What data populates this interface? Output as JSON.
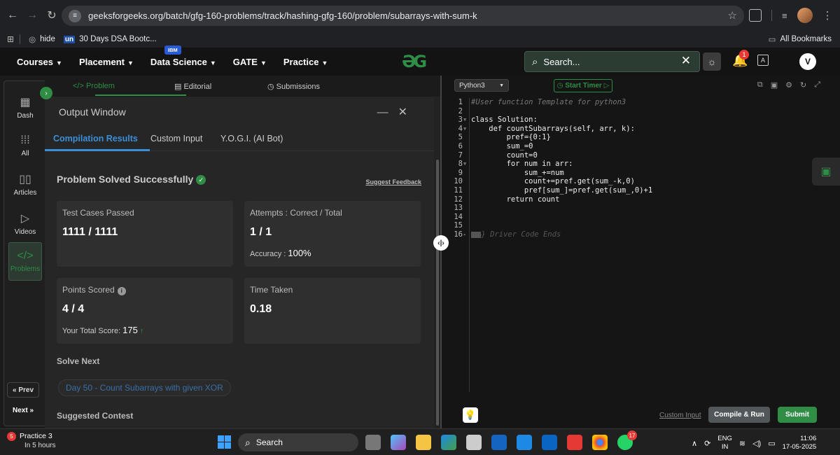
{
  "browser": {
    "url": "geeksforgeeks.org/batch/gfg-160-problems/track/hashing-gfg-160/problem/subarrays-with-sum-k",
    "bookmarks": [
      "hide",
      "30 Days DSA Bootc..."
    ],
    "bookmark_badge": "un",
    "all_bookmarks": "All Bookmarks"
  },
  "nav": {
    "items": [
      "Courses",
      "Placement",
      "Data Science",
      "GATE",
      "Practice"
    ],
    "ibm_badge": "IBM",
    "search_placeholder": "Search...",
    "notif_count": "1",
    "user_initial": "V"
  },
  "rail": {
    "items": [
      "Dash",
      "All",
      "Articles",
      "Videos",
      "Problems"
    ],
    "prev": "« Prev",
    "next": "Next »"
  },
  "tabs": [
    "</> Problem",
    "Editorial",
    "Submissions"
  ],
  "output": {
    "title": "Output Window",
    "subtabs": [
      "Compilation Results",
      "Custom Input",
      "Y.O.G.I. (AI Bot)"
    ],
    "status": "Problem Solved Successfully",
    "feedback": "Suggest Feedback",
    "cards": {
      "tests_label": "Test Cases Passed",
      "tests_value": "1111 / 1111",
      "attempts_label": "Attempts : Correct / Total",
      "attempts_value": "1 / 1",
      "accuracy_label": "Accuracy :",
      "accuracy_value": "100%",
      "points_label": "Points Scored",
      "points_value": "4 / 4",
      "total_label": "Your Total Score:",
      "total_value": "175",
      "time_label": "Time Taken",
      "time_value": "0.18"
    },
    "solve_next": "Solve Next",
    "next_problem": "Day 50 - Count Subarrays with given XOR",
    "suggested_contest": "Suggested Contest"
  },
  "editor": {
    "language": "Python3",
    "timer": "Start Timer",
    "custom_input": "Custom Input",
    "compile": "Compile & Run",
    "submit": "Submit",
    "lines": [
      "#User function Template for python3",
      "",
      "class Solution:",
      "    def countSubarrays(self, arr, k):",
      "        pref={0:1}",
      "        sum_=0",
      "        count=0",
      "        for num in arr:",
      "            sum_+=num",
      "            count+=pref.get(sum_-k,0)",
      "            pref[sum_]=pref.get(sum_,0)+1",
      "        return count",
      "",
      "",
      "",
      "} Driver Code Ends"
    ]
  },
  "taskbar": {
    "app_title": "Practice 3",
    "app_sub": "In 5 hours",
    "app_badge": "5",
    "search": "Search",
    "whatsapp_badge": "17",
    "lang": "ENG",
    "region": "IN",
    "time": "11:06",
    "date": "17-05-2025"
  }
}
